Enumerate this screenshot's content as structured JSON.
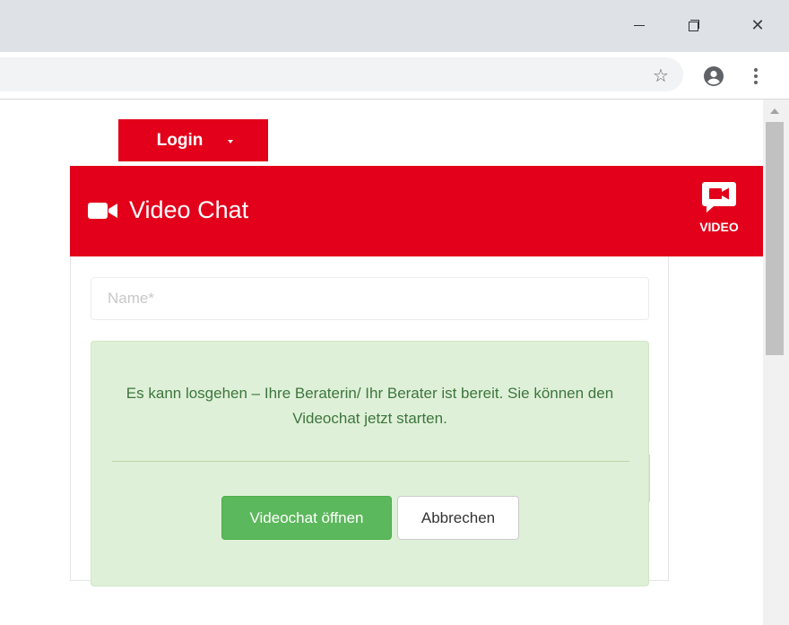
{
  "browser": {
    "window_controls": {
      "minimize_icon": "minimize-icon",
      "maximize_icon": "restore-icon",
      "close_glyph": "✕"
    },
    "toolbar": {
      "star_glyph": "☆",
      "account_icon": "account-icon",
      "menu_icon": "kebab-menu-icon"
    }
  },
  "page": {
    "login_label": "Login",
    "video_chat": {
      "title": "Video Chat",
      "badge_label": "VIDEO"
    },
    "form": {
      "name_placeholder": "Name*",
      "name_value": ""
    },
    "alert": {
      "message": "Es kann losgehen – Ihre Beraterin/ Ihr Berater ist bereit. Sie können den Videochat jetzt starten.",
      "open_button": "Videochat öffnen",
      "cancel_button": "Abbrechen"
    }
  },
  "colors": {
    "brand_red": "#e2001a",
    "success_green": "#5cb85c",
    "alert_bg": "#dff0d8",
    "alert_text": "#3c763d"
  }
}
